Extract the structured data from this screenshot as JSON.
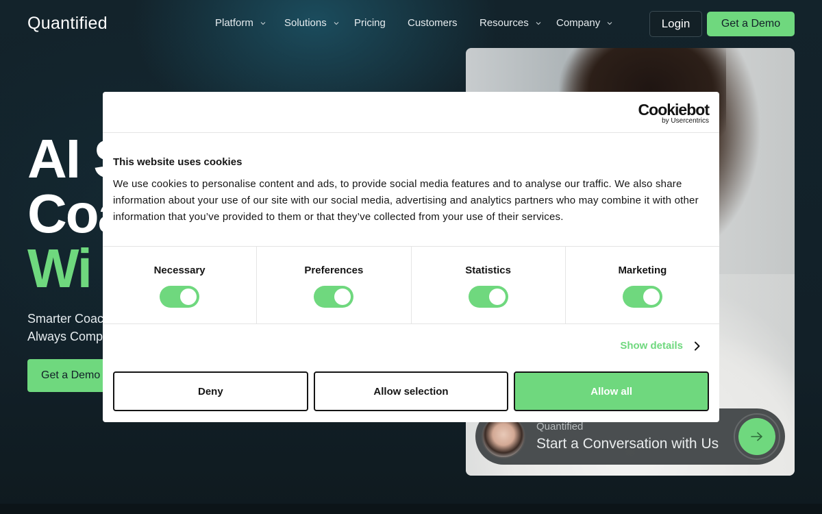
{
  "nav": {
    "logo": "Quantified",
    "items": [
      {
        "label": "Platform",
        "dropdown": true
      },
      {
        "label": "Solutions",
        "dropdown": true
      },
      {
        "label": "Pricing",
        "dropdown": false
      },
      {
        "label": "Customers",
        "dropdown": false
      },
      {
        "label": "Resources",
        "dropdown": true
      },
      {
        "label": "Company",
        "dropdown": true
      }
    ],
    "login_label": "Login",
    "demo_label": "Get a Demo"
  },
  "hero": {
    "title_line1": "AI S",
    "title_line2": "Coa",
    "title_line3": "Wi",
    "subtitle_line1": "Smarter Coac",
    "subtitle_line2": "Always Comp",
    "cta_label": "Get a Demo"
  },
  "chat": {
    "brand": "Quantified",
    "text": "Start a Conversation with Us",
    "button_icon": "arrow-right-icon"
  },
  "cookie_modal": {
    "brand_name": "Cookiebot",
    "brand_by": "by Usercentrics",
    "title": "This website uses cookies",
    "body": "We use cookies to personalise content and ads, to provide social media features and to analyse our traffic. We also share information about your use of our site with our social media, advertising and analytics partners who may combine it with other information that you’ve provided to them or that they’ve collected from your use of their services.",
    "categories": [
      {
        "label": "Necessary",
        "enabled": true
      },
      {
        "label": "Preferences",
        "enabled": true
      },
      {
        "label": "Statistics",
        "enabled": true
      },
      {
        "label": "Marketing",
        "enabled": true
      }
    ],
    "show_details_label": "Show details",
    "deny_label": "Deny",
    "allow_selection_label": "Allow selection",
    "allow_all_label": "Allow all"
  },
  "colors": {
    "accent": "#6fd87e",
    "background": "#111c22",
    "modal_bg": "#ffffff",
    "text_dark": "#141414"
  }
}
